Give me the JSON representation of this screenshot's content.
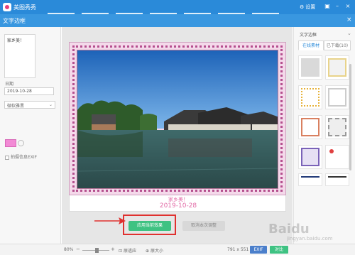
{
  "app": {
    "name": "美图秀秀",
    "settings_label": "设置"
  },
  "subbar": {
    "title": "文字边框"
  },
  "left": {
    "text_value": "家乡美！",
    "date_label": "日期",
    "date_value": "2019-10-28",
    "font_select": "微软雅黑",
    "color_swatch": "#f28ad5",
    "exif_label": "拍摄信息EXIF"
  },
  "canvas": {
    "caption_line1": "家乡美！",
    "caption_line2": "2019-10-28",
    "apply_button": "应用当前效果",
    "cancel_button": "取消本次调整"
  },
  "right": {
    "title": "文字边框",
    "tabs": [
      "在线素材",
      "已下载(10)"
    ]
  },
  "status": {
    "zoom": "80%",
    "fit_label": "原适应",
    "original_label": "原大小",
    "dimensions": "791 x 551",
    "exif_button": "EXIF",
    "compare_button": "对比"
  },
  "watermark": {
    "text": "Baidu",
    "sub": "jingyan.baidu.com"
  },
  "colors": {
    "titlebar": "#2a8ad9",
    "accent_green": "#3ec282",
    "highlight_red": "#e0312f",
    "caption_pink": "#e26aa6"
  }
}
